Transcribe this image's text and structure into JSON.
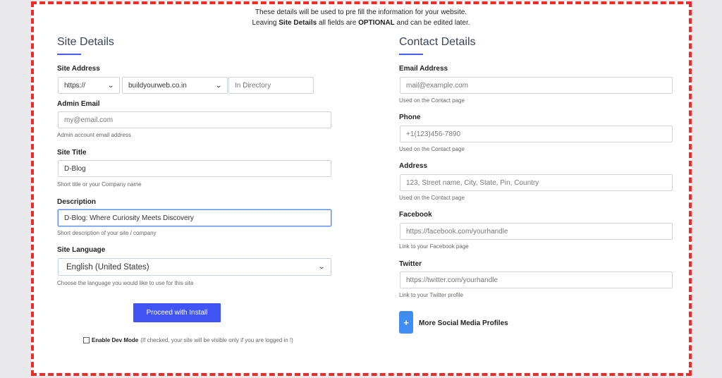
{
  "notice": {
    "line1": "These details will be used to pre fill the information for your website.",
    "line2_pre": "Leaving ",
    "line2_bold1": "Site Details",
    "line2_mid": " all fields are ",
    "line2_bold2": "OPTIONAL",
    "line2_post": " and can be edited later."
  },
  "site": {
    "title": "Site Details",
    "address": {
      "label": "Site Address",
      "protocol": "https://",
      "domain": "buildyourweb.co.in",
      "directory_placeholder": "In Directory"
    },
    "admin_email": {
      "label": "Admin Email",
      "placeholder": "my@email.com",
      "help": "Admin account email address"
    },
    "site_title": {
      "label": "Site Title",
      "value": "D-Blog",
      "help": "Short title or your Company name"
    },
    "description": {
      "label": "Description",
      "value": "D-Blog: Where Curiosity Meets Discovery",
      "help": "Short description of your site / company"
    },
    "language": {
      "label": "Site Language",
      "value": "English (United States)",
      "help": "Choose the language you would like to use for this site"
    },
    "proceed_label": "Proceed with Install",
    "dev_mode": {
      "label": "Enable Dev Mode",
      "note": "(If checked, your site will be visible only if you are logged in !)"
    }
  },
  "contact": {
    "title": "Contact Details",
    "email": {
      "label": "Email Address",
      "placeholder": "mail@example.com",
      "help": "Used on the Contact page"
    },
    "phone": {
      "label": "Phone",
      "placeholder": "+1(123)456-7890",
      "help": "Used on the Contact page"
    },
    "address": {
      "label": "Address",
      "placeholder": "123, Street name, City, State, Pin, Country",
      "help": "Used on the Contact page"
    },
    "facebook": {
      "label": "Facebook",
      "placeholder": "https://facebook.com/yourhandle",
      "help": "Link to your Facebook page"
    },
    "twitter": {
      "label": "Twitter",
      "placeholder": "https://twitter.com/yourhandle",
      "help": "Link to your Twitter profile"
    },
    "more_social_label": "More Social Media Profiles",
    "plus_symbol": "+"
  },
  "colors": {
    "accent": "#4054f4",
    "border_dash": "#ee2a2a",
    "plus_button": "#3f8cf2"
  }
}
